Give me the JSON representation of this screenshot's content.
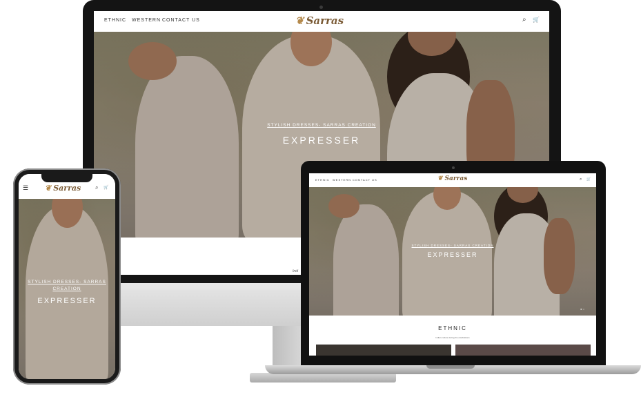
{
  "site": {
    "logo_text": "Sarras",
    "logo_ornament": "❦",
    "nav": [
      "ETHNIC",
      "WESTERN",
      "CONTACT US"
    ],
    "icons": {
      "search": "⌕",
      "cart": "🛒",
      "menu": "☰"
    },
    "hero_subtitle": "STYLISH DRESSES- SARRAS CREATION",
    "hero_title": "EXPRESSER"
  },
  "monitor": {
    "footer_snippet": "Indi"
  },
  "laptop": {
    "section_title": "ETHNIC",
    "section_text": "Indian culture during the celebrations",
    "slider_dots": "● ○"
  },
  "phone": {
    "hero_subtitle_line1": "STYLISH DRESSES- SARRAS",
    "hero_subtitle_line2": "CREATION"
  },
  "colors": {
    "accent_logo": "#7a5a34",
    "nav_text": "#333333",
    "hero_text": "#ffffff"
  }
}
